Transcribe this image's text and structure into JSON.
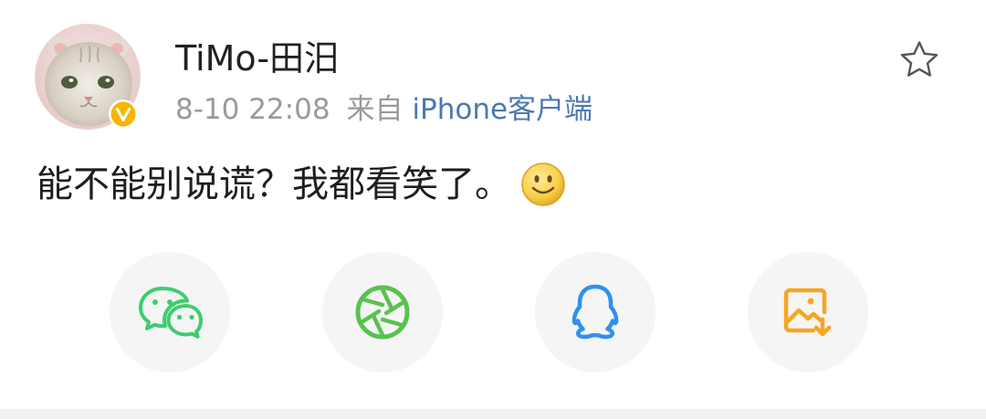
{
  "user": {
    "name": "TiMo-田汨",
    "verified_badge": "V"
  },
  "meta": {
    "timestamp": "8-10 22:08",
    "source_prefix": "来自",
    "source": "iPhone客户端"
  },
  "post": {
    "text": "能不能别说谎？我都看笑了。",
    "emoji": "smile-emoji"
  },
  "share": {
    "icons": [
      "wechat-icon",
      "moments-icon",
      "qq-icon",
      "save-image-icon"
    ]
  },
  "colors": {
    "wechat": "#3ecd6e",
    "moments": "#59c24e",
    "qq": "#2d91f0",
    "save": "#f5a623",
    "link": "#4b78b0",
    "badge": "#f7b500"
  }
}
